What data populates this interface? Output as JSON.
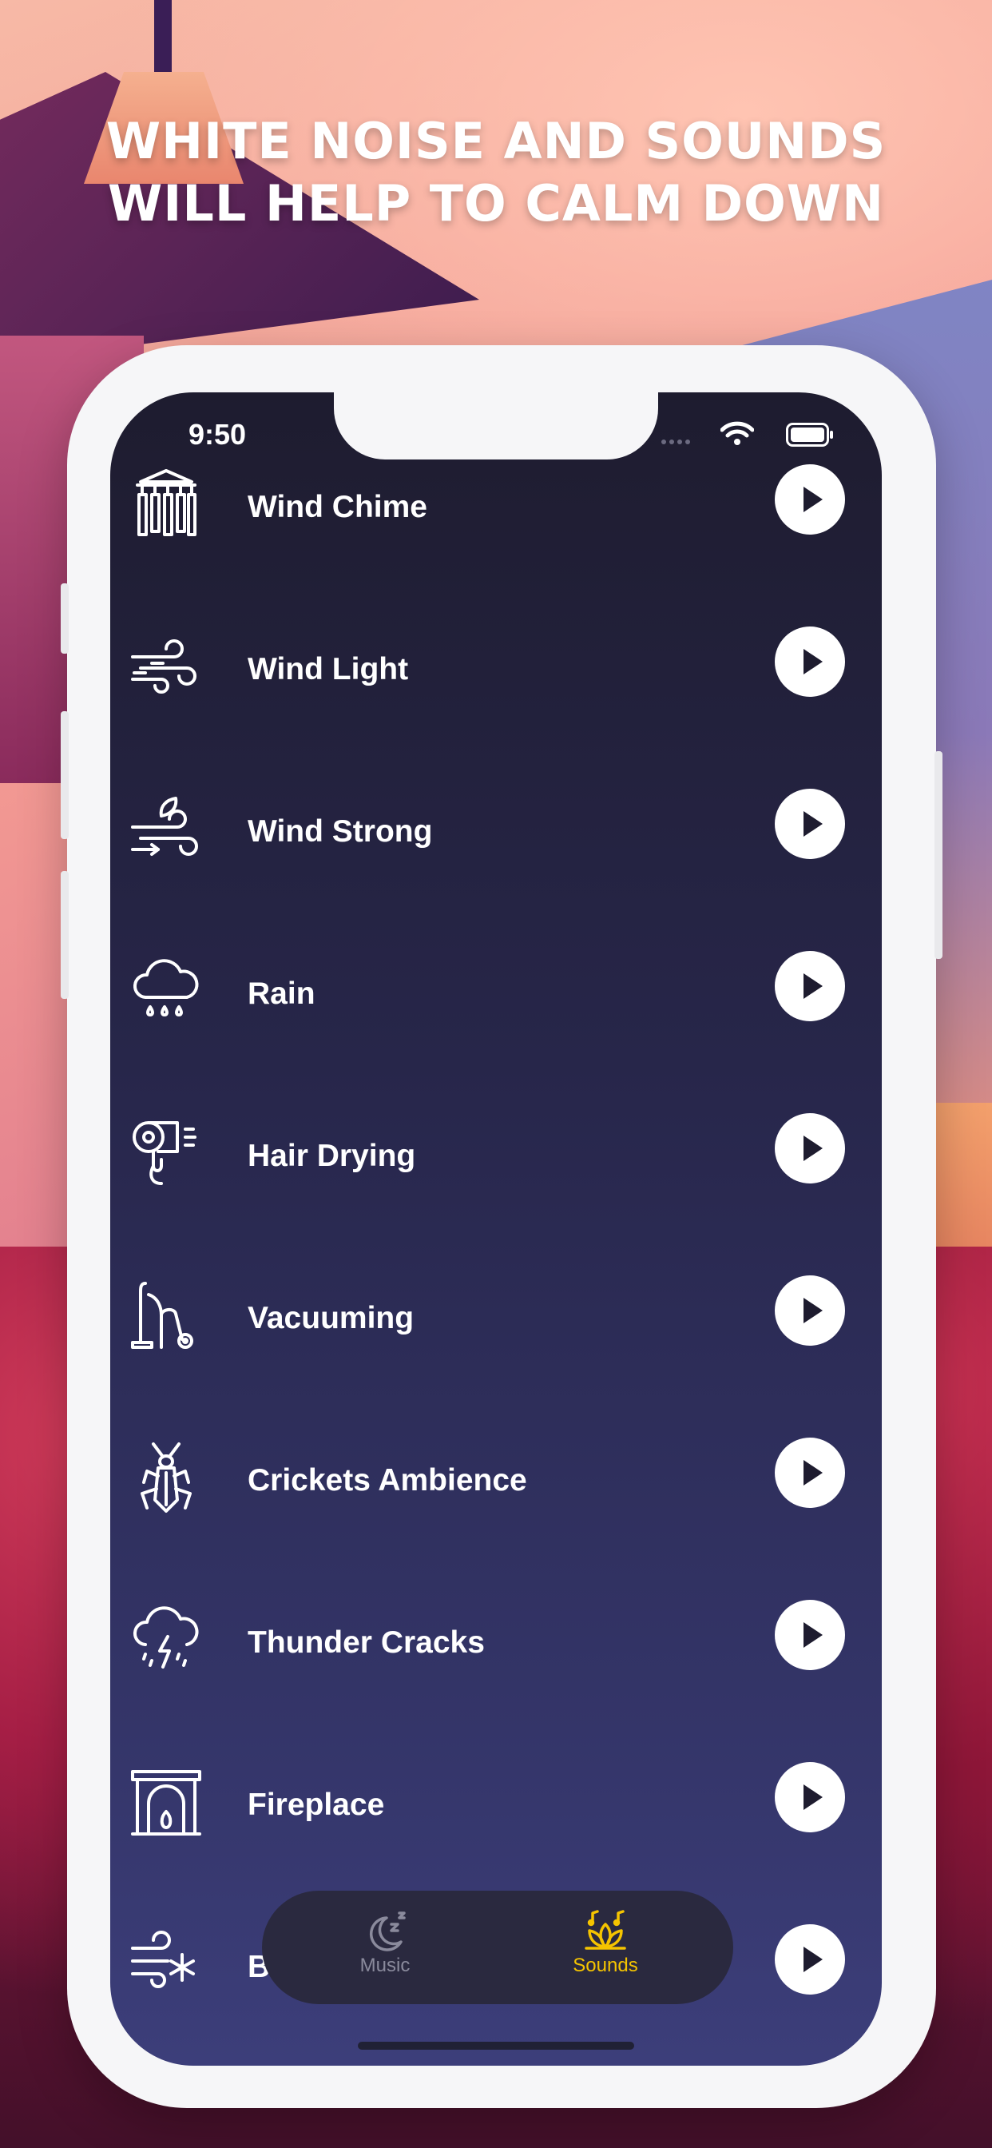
{
  "headline": {
    "line1": "WHITE NOISE AND SOUNDS",
    "line2": "WILL HELP TO CALM DOWN"
  },
  "status_bar": {
    "time": "9:50"
  },
  "sounds": [
    {
      "label": "Wind Chime",
      "icon": "wind-chime-icon"
    },
    {
      "label": "Wind Light",
      "icon": "wind-light-icon"
    },
    {
      "label": "Wind Strong",
      "icon": "wind-strong-icon"
    },
    {
      "label": "Rain",
      "icon": "rain-cloud-icon"
    },
    {
      "label": "Hair Drying",
      "icon": "hair-dryer-icon"
    },
    {
      "label": "Vacuuming",
      "icon": "vacuum-cleaner-icon"
    },
    {
      "label": "Crickets Ambience",
      "icon": "cricket-icon"
    },
    {
      "label": "Thunder Cracks",
      "icon": "thunder-cloud-icon"
    },
    {
      "label": "Fireplace",
      "icon": "fireplace-icon"
    },
    {
      "label": "Blizzard",
      "icon": "blizzard-icon"
    }
  ],
  "tabs": [
    {
      "label": "Music",
      "icon": "moon-sleep-icon",
      "active": false
    },
    {
      "label": "Sounds",
      "icon": "lotus-music-icon",
      "active": true
    }
  ],
  "colors": {
    "active_tab": "#f5c400",
    "inactive_tab": "#8a8a9c",
    "screen_top": "#1e1c2f",
    "screen_bottom": "#3c3e7a"
  }
}
